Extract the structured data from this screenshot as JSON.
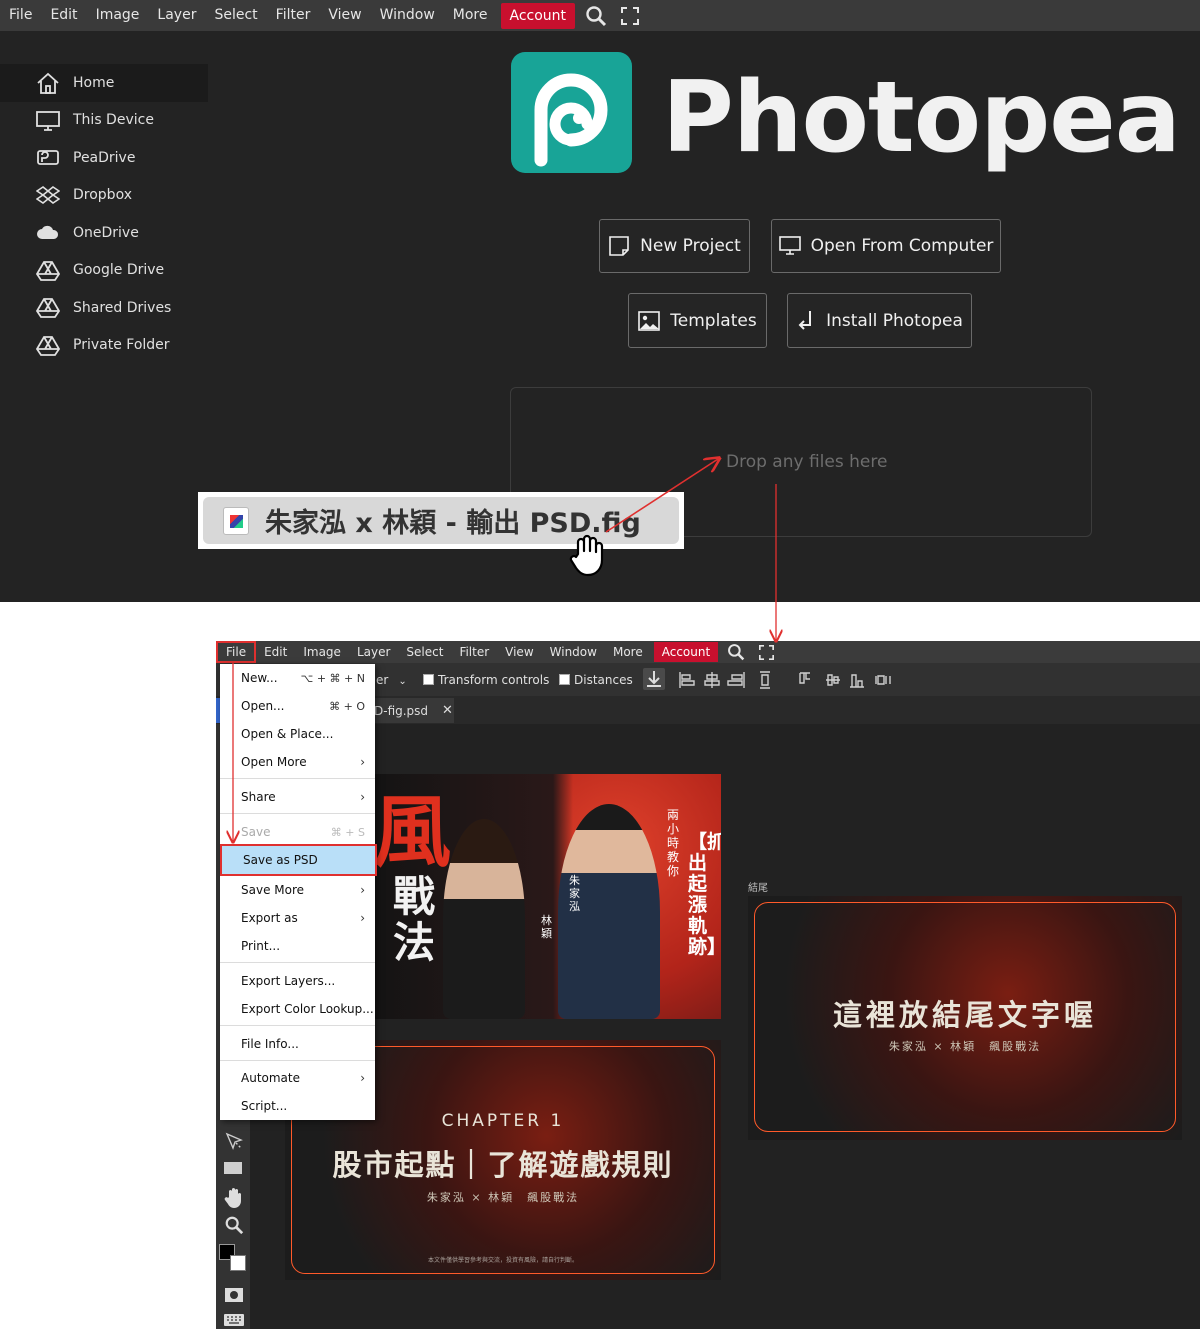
{
  "top": {
    "menu": [
      "File",
      "Edit",
      "Image",
      "Layer",
      "Select",
      "Filter",
      "View",
      "Window",
      "More"
    ],
    "account": "Account",
    "sidebar": [
      {
        "label": "Home",
        "icon": "home-icon",
        "active": true
      },
      {
        "label": "This Device",
        "icon": "monitor-icon",
        "active": false
      },
      {
        "label": "PeaDrive",
        "icon": "peadrive-icon",
        "active": false
      },
      {
        "label": "Dropbox",
        "icon": "dropbox-icon",
        "active": false
      },
      {
        "label": "OneDrive",
        "icon": "cloud-icon",
        "active": false
      },
      {
        "label": "Google Drive",
        "icon": "drive-icon",
        "active": false
      },
      {
        "label": "Shared Drives",
        "icon": "drive-icon",
        "active": false
      },
      {
        "label": "Private Folder",
        "icon": "drive-icon",
        "active": false
      }
    ],
    "brand": "Photopea",
    "buttons": {
      "new_project": "New Project",
      "open_computer": "Open From Computer",
      "templates": "Templates",
      "install": "Install Photopea"
    },
    "drop_text": "Drop any files here",
    "dragged_file": "朱家泓 x 林穎 - 輸出 PSD.fig"
  },
  "bottom": {
    "menu": [
      "File",
      "Edit",
      "Image",
      "Layer",
      "Select",
      "Filter",
      "View",
      "Window",
      "More"
    ],
    "account": "Account",
    "toolbar": {
      "select_partial": "er",
      "transform_controls": "Transform controls",
      "distances": "Distances"
    },
    "tab_name": "D-fig.psd",
    "file_menu": [
      {
        "label": "New...",
        "shortcut": "⌥ + ⌘ + N"
      },
      {
        "label": "Open...",
        "shortcut": "⌘ + O"
      },
      {
        "label": "Open & Place..."
      },
      {
        "label": "Open More",
        "submenu": true
      },
      {
        "label": "Share",
        "submenu": true
      },
      {
        "label": "Save",
        "shortcut": "⌘ + S",
        "disabled": true
      },
      {
        "label": "Save as PSD",
        "highlighted": true
      },
      {
        "label": "Save More",
        "submenu": true
      },
      {
        "label": "Export as",
        "submenu": true
      },
      {
        "label": "Print..."
      },
      {
        "label": "Export Layers..."
      },
      {
        "label": "Export Color Lookup..."
      },
      {
        "label": "File Info..."
      },
      {
        "label": "Automate",
        "submenu": true
      },
      {
        "label": "Script..."
      }
    ],
    "cover": {
      "left_chars": "風",
      "left_chars2": "戰\n法",
      "vertical_main": "【抓出起漲軌跡】",
      "vertical_small": "兩小時教你",
      "name_1": "朱家泓",
      "name_2": "林穎"
    },
    "chapter_slide": {
      "chapter": "CHAPTER 1",
      "title": "股市起點｜了解遊戲規則",
      "sub": "朱家泓 × 林穎　飆股戰法",
      "footer": "本文件僅供學習參考與交流，投資有風險，請自行判斷。"
    },
    "ending_label": "結尾",
    "ending_slide": {
      "title": "這裡放結尾文字喔",
      "sub": "朱家泓 × 林穎　飆股戰法"
    }
  },
  "colors": {
    "accent_red": "#c8102e",
    "annotation_red": "#e0302f",
    "brand_teal": "#18a497",
    "highlight_blue": "#b9dff8"
  }
}
